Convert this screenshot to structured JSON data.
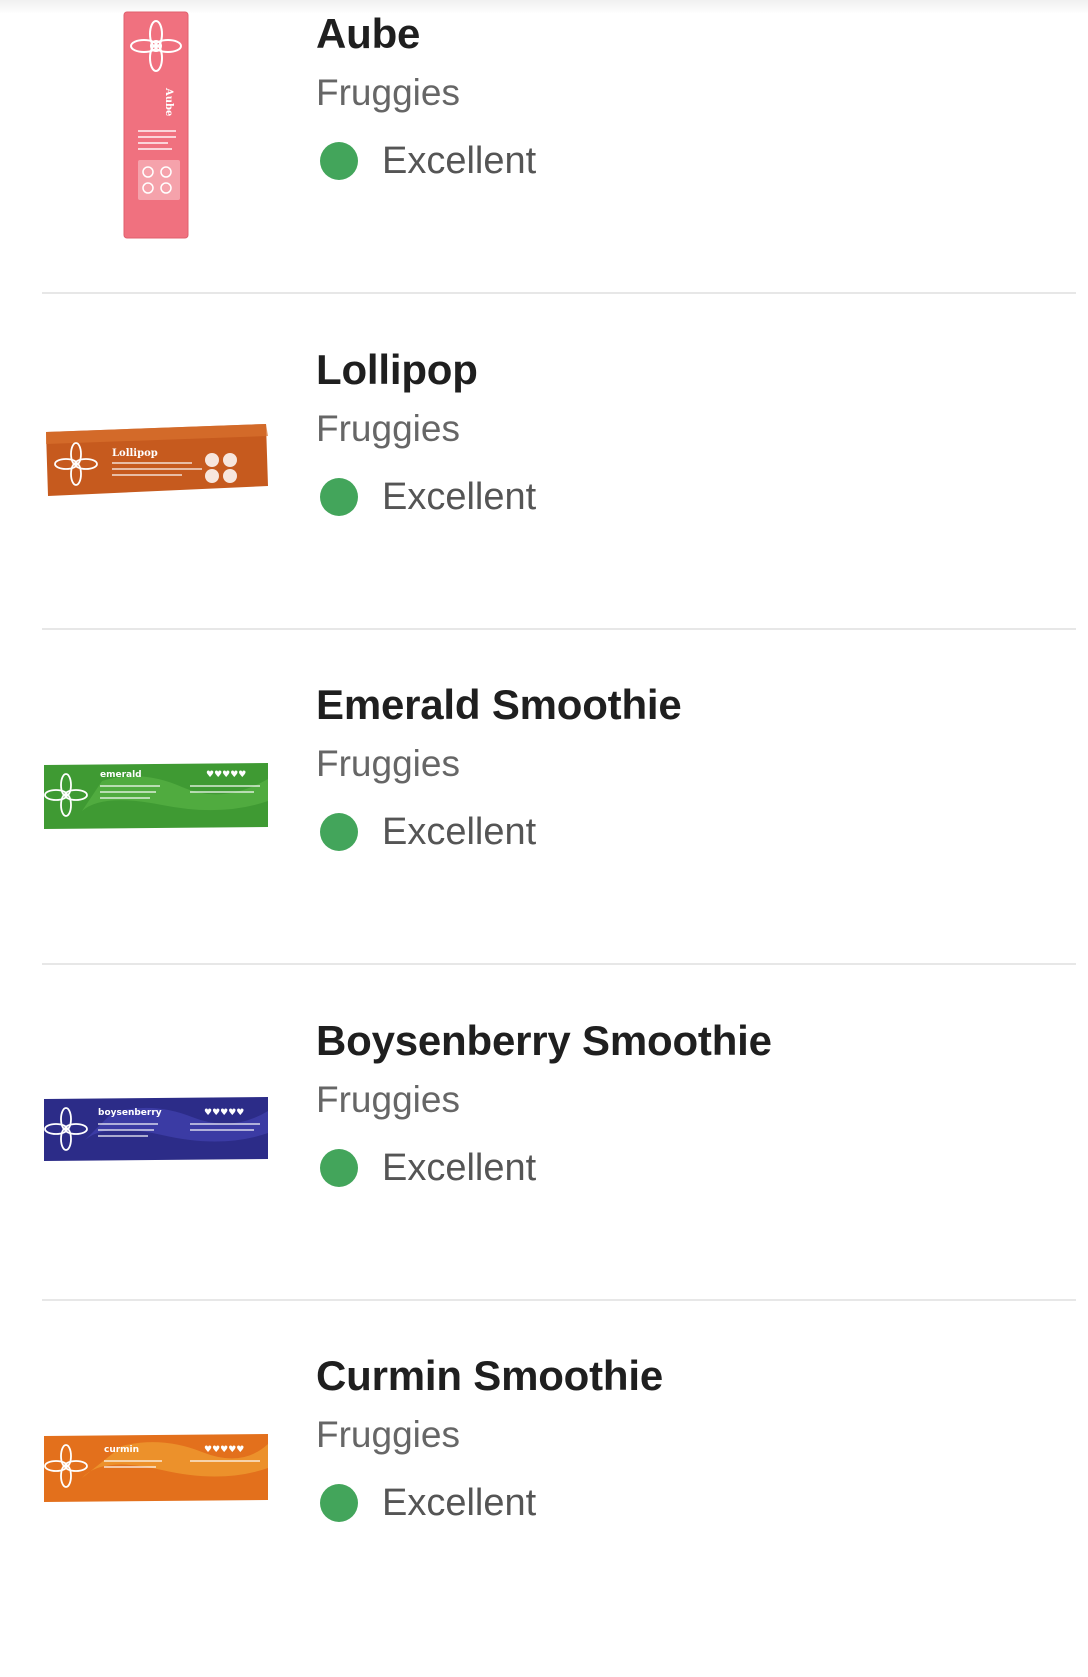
{
  "products": [
    {
      "name": "Aube",
      "brand": "Fruggies",
      "score_label": "Excellent",
      "score_color": "#43a55b",
      "image": {
        "kind": "vertical-stick-pack",
        "color": "#f0717f",
        "pack_text": "Aube"
      }
    },
    {
      "name": "Lollipop",
      "brand": "Fruggies",
      "score_label": "Excellent",
      "score_color": "#43a55b",
      "image": {
        "kind": "horizontal-stick-pack",
        "color": "#c65a1e",
        "pack_text": "Lollipop"
      }
    },
    {
      "name": "Emerald Smoothie",
      "brand": "Fruggies",
      "score_label": "Excellent",
      "score_color": "#43a55b",
      "image": {
        "kind": "horizontal-stick-pack",
        "color": "#3f9a33",
        "pack_text": "emerald"
      }
    },
    {
      "name": "Boysenberry Smoothie",
      "brand": "Fruggies",
      "score_label": "Excellent",
      "score_color": "#43a55b",
      "image": {
        "kind": "horizontal-stick-pack",
        "color": "#2c2c88",
        "pack_text": "boysenberry"
      }
    },
    {
      "name": "Curmin Smoothie",
      "brand": "Fruggies",
      "score_label": "Excellent",
      "score_color": "#43a55b",
      "image": {
        "kind": "horizontal-stick-pack",
        "color": "#e3701c",
        "pack_text": "curmin"
      }
    }
  ]
}
